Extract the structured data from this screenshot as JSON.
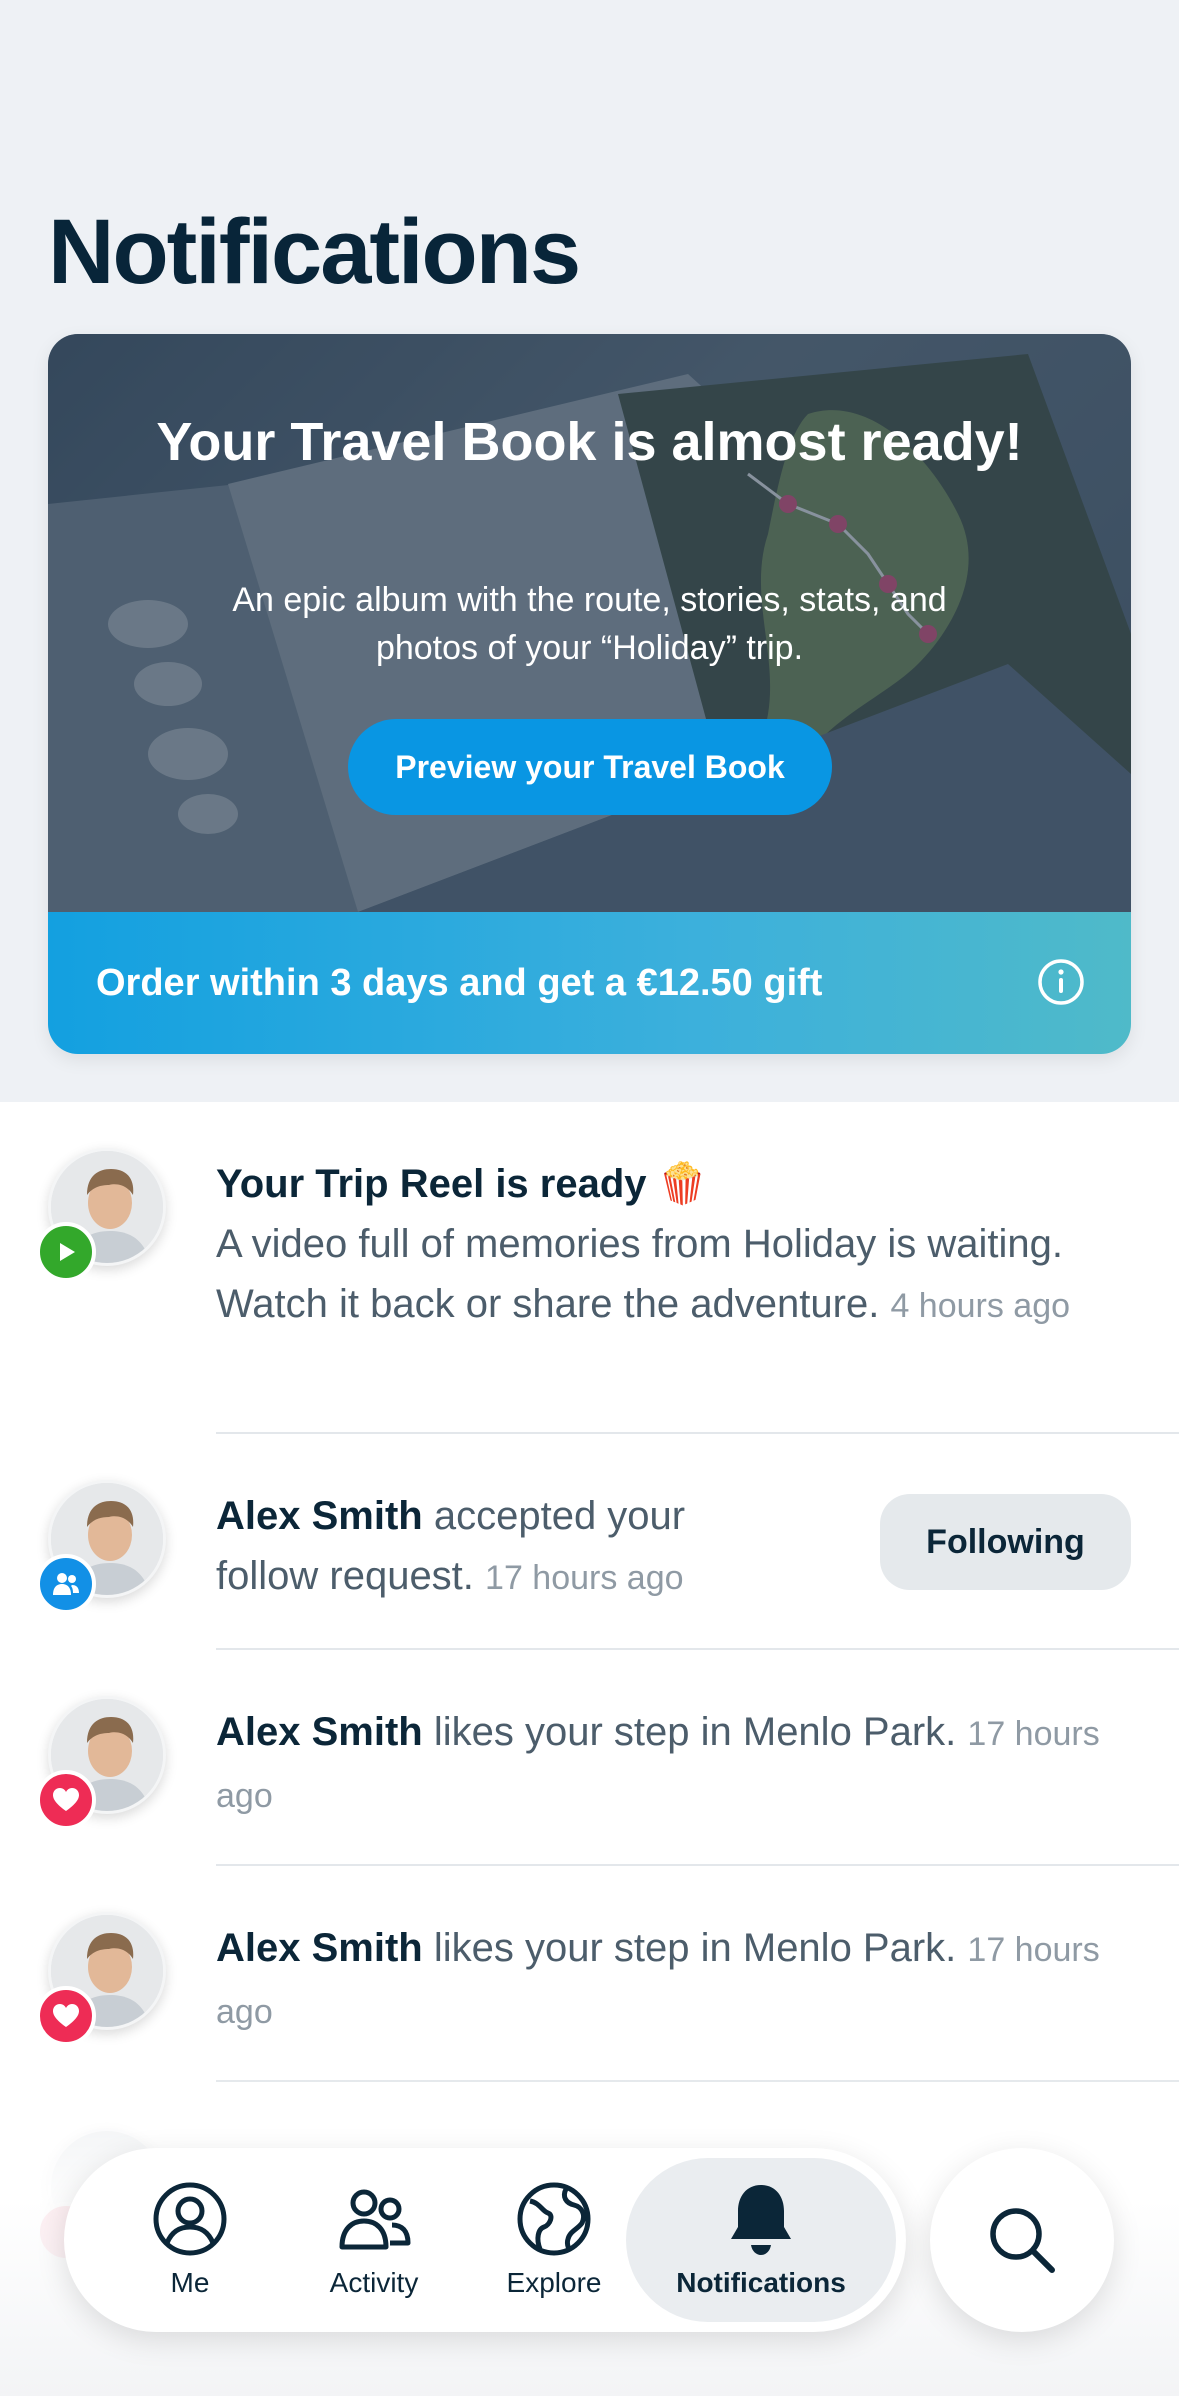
{
  "header": {
    "title": "Notifications"
  },
  "travel_book": {
    "title": "Your Travel Book is almost ready!",
    "subtitle": "An epic album with the route, stories, stats, and photos of your “Holiday” trip.",
    "preview_button": "Preview your Travel Book",
    "offer": "Order within 3 days and get a €12.50 gift",
    "colors": {
      "button": "#0996e3",
      "footer": "#13a0e0"
    }
  },
  "notifications": [
    {
      "title": "Your Trip Reel is ready 🍿",
      "body": "A video full of memories from Holiday is waiting. Watch it back or share the adventure.",
      "time": "4 hours ago",
      "badge": "play-icon"
    },
    {
      "name": "Alex Smith",
      "body": "accepted your follow request.",
      "time": "17 hours ago",
      "badge": "people-icon",
      "action": "Following"
    },
    {
      "name": "Alex Smith",
      "body": "likes your step in Menlo Park.",
      "time": "17 hours ago",
      "badge": "heart-icon"
    },
    {
      "name": "Alex Smith",
      "body": "likes your step in Menlo Park.",
      "time": "17 hours ago",
      "badge": "heart-icon"
    }
  ],
  "tabbar": {
    "tabs": [
      {
        "label": "Me",
        "icon": "person-icon"
      },
      {
        "label": "Activity",
        "icon": "people-icon"
      },
      {
        "label": "Explore",
        "icon": "globe-icon"
      },
      {
        "label": "Notifications",
        "icon": "bell-icon",
        "active": true
      }
    ],
    "search_icon": "search-icon"
  }
}
